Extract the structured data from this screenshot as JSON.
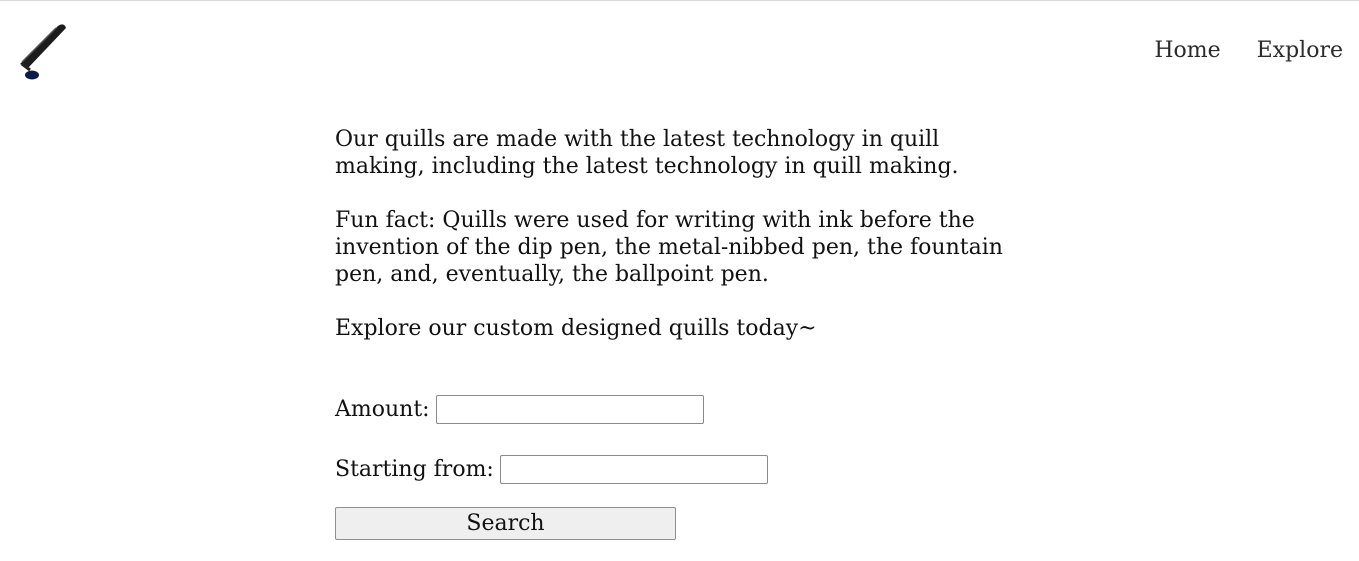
{
  "nav": {
    "items": [
      {
        "label": "Home"
      },
      {
        "label": "Explore"
      }
    ]
  },
  "logo": {
    "icon": "quill-icon"
  },
  "intro": {
    "paragraphs": [
      "Our quills are made with the latest technology in quill making, including the latest technology in quill making.",
      "Fun fact: Quills were used for writing with ink before the invention of the dip pen, the metal-nibbed pen, the fountain pen, and, eventually, the ballpoint pen.",
      "Explore our custom designed quills today~"
    ]
  },
  "form": {
    "amount_label": "Amount:",
    "amount_value": "",
    "start_label": "Starting from:",
    "start_value": "",
    "search_label": "Search"
  }
}
